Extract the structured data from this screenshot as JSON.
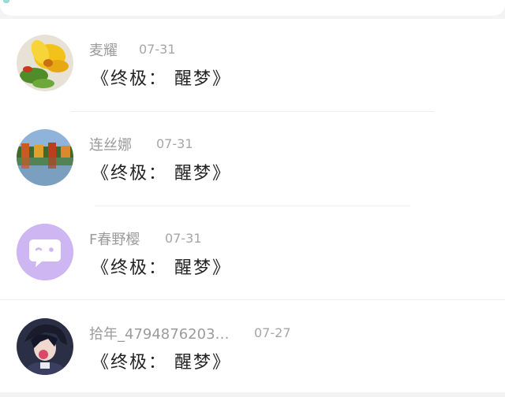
{
  "comments": [
    {
      "name": "麦耀",
      "time": "07-31",
      "content": "《终极： 醒梦》",
      "avatar": "flower-avatar"
    },
    {
      "name": "连丝娜",
      "time": "07-31",
      "content": "《终极： 醒梦》",
      "avatar": "lake-avatar"
    },
    {
      "name": "F春野樱",
      "time": "07-31",
      "content": "《终极： 醒梦》",
      "avatar": "default-chat-avatar"
    },
    {
      "name": "拾年_4794876203…",
      "time": "07-27",
      "content": "《终极： 醒梦》",
      "avatar": "anime-avatar"
    }
  ],
  "colors": {
    "default_avatar_bg": "#cdb6f2",
    "text_dark": "#222222",
    "text_gray": "#9b9b9b"
  }
}
